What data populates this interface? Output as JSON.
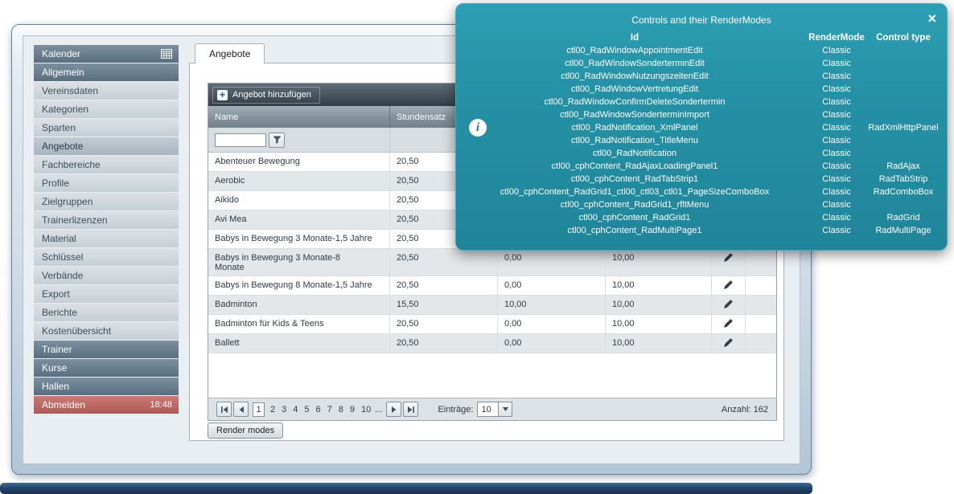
{
  "sidebar": {
    "items": [
      {
        "label": "Kalender",
        "variant": "dark",
        "time": ""
      },
      {
        "label": "Allgemein",
        "variant": "dark",
        "time": ""
      },
      {
        "label": "Vereinsdaten",
        "variant": "light",
        "time": ""
      },
      {
        "label": "Kategorien",
        "variant": "light",
        "time": ""
      },
      {
        "label": "Sparten",
        "variant": "light",
        "time": ""
      },
      {
        "label": "Angebote",
        "variant": "selected",
        "time": ""
      },
      {
        "label": "Fachbereiche",
        "variant": "light",
        "time": ""
      },
      {
        "label": "Profile",
        "variant": "light",
        "time": ""
      },
      {
        "label": "Zielgruppen",
        "variant": "light",
        "time": ""
      },
      {
        "label": "Trainerlizenzen",
        "variant": "light",
        "time": ""
      },
      {
        "label": "Material",
        "variant": "light",
        "time": ""
      },
      {
        "label": "Schlüssel",
        "variant": "light",
        "time": ""
      },
      {
        "label": "Verbände",
        "variant": "light",
        "time": ""
      },
      {
        "label": "Export",
        "variant": "light",
        "time": ""
      },
      {
        "label": "Berichte",
        "variant": "light",
        "time": ""
      },
      {
        "label": "Kostenübersicht",
        "variant": "light",
        "time": ""
      },
      {
        "label": "Trainer",
        "variant": "dark",
        "time": ""
      },
      {
        "label": "Kurse",
        "variant": "dark",
        "time": ""
      },
      {
        "label": "Hallen",
        "variant": "dark",
        "time": ""
      },
      {
        "label": "Abmelden",
        "variant": "logout",
        "time": "18:48"
      }
    ]
  },
  "tabs": {
    "active": "Angebote"
  },
  "grid": {
    "toolbar": {
      "add_label": "Angebot hinzufügen",
      "plus_label": "+"
    },
    "columns": {
      "name": "Name",
      "rate": "Stundensatz",
      "c3": "",
      "c4": ""
    },
    "filter": {
      "name_value": ""
    },
    "rows": [
      {
        "name": "Abenteuer Bewegung",
        "rate": "20,50",
        "c3": "",
        "c4": ""
      },
      {
        "name": "Aerobic",
        "rate": "20,50",
        "c3": "",
        "c4": ""
      },
      {
        "name": "Aikido",
        "rate": "20,50",
        "c3": "",
        "c4": ""
      },
      {
        "name": "Avi Mea",
        "rate": "20,50",
        "c3": "",
        "c4": ""
      },
      {
        "name": "Babys in Bewegung 3 Monate-1,5 Jahre",
        "rate": "20,50",
        "c3": "",
        "c4": ""
      },
      {
        "name": "Babys in Bewegung 3 Monate-8 Monate",
        "rate": "20,50",
        "c3": "0,00",
        "c4": "10,00"
      },
      {
        "name": "Babys in Bewegung 8 Monate-1,5 Jahre",
        "rate": "20,50",
        "c3": "0,00",
        "c4": "10,00"
      },
      {
        "name": "Badminton",
        "rate": "15,50",
        "c3": "10,00",
        "c4": "10,00"
      },
      {
        "name": "Badminton für Kids & Teens",
        "rate": "20,50",
        "c3": "0,00",
        "c4": "10,00"
      },
      {
        "name": "Ballett",
        "rate": "20,50",
        "c3": "0,00",
        "c4": "10,00"
      }
    ],
    "pager": {
      "current": "1",
      "pages": [
        "2",
        "3",
        "4",
        "5",
        "6",
        "7",
        "8",
        "9",
        "10"
      ],
      "ellipsis": "...",
      "entries_label": "Einträge:",
      "page_size": "10",
      "count_label": "Anzahl: 162"
    }
  },
  "render_modes": {
    "label": "Render modes"
  },
  "overlay": {
    "title": "Controls and their RenderModes",
    "close_label": "×",
    "info_label": "i",
    "columns": [
      "Id",
      "RenderMode",
      "Control type"
    ],
    "rows": [
      {
        "id": "ctl00_RadWindowAppointmentEdit",
        "mode": "Classic",
        "type": ""
      },
      {
        "id": "ctl00_RadWindowSonderterminEdit",
        "mode": "Classic",
        "type": ""
      },
      {
        "id": "ctl00_RadWindowNutzungszeitenEdit",
        "mode": "Classic",
        "type": ""
      },
      {
        "id": "ctl00_RadWindowVertretungEdit",
        "mode": "Classic",
        "type": ""
      },
      {
        "id": "ctl00_RadWindowConfirmDeleteSondertermin",
        "mode": "Classic",
        "type": ""
      },
      {
        "id": "ctl00_RadWindowSonderterminImport",
        "mode": "Classic",
        "type": ""
      },
      {
        "id": "ctl00_RadNotification_XmlPanel",
        "mode": "Classic",
        "type": "RadXmlHttpPanel"
      },
      {
        "id": "ctl00_RadNotification_TitleMenu",
        "mode": "Classic",
        "type": ""
      },
      {
        "id": "ctl00_RadNotification",
        "mode": "Classic",
        "type": ""
      },
      {
        "id": "ctl00_cphContent_RadAjaxLoadingPanel1",
        "mode": "Classic",
        "type": "RadAjax"
      },
      {
        "id": "ctl00_cphContent_RadTabStrip1",
        "mode": "Classic",
        "type": "RadTabStrip"
      },
      {
        "id": "ctl00_cphContent_RadGrid1_ctl00_ctl03_ctl01_PageSizeComboBox",
        "mode": "Classic",
        "type": "RadComboBox"
      },
      {
        "id": "ctl00_cphContent_RadGrid1_rfltMenu",
        "mode": "Classic",
        "type": ""
      },
      {
        "id": "ctl00_cphContent_RadGrid1",
        "mode": "Classic",
        "type": "RadGrid"
      },
      {
        "id": "ctl00_cphContent_RadMultiPage1",
        "mode": "Classic",
        "type": "RadMultiPage"
      }
    ]
  }
}
